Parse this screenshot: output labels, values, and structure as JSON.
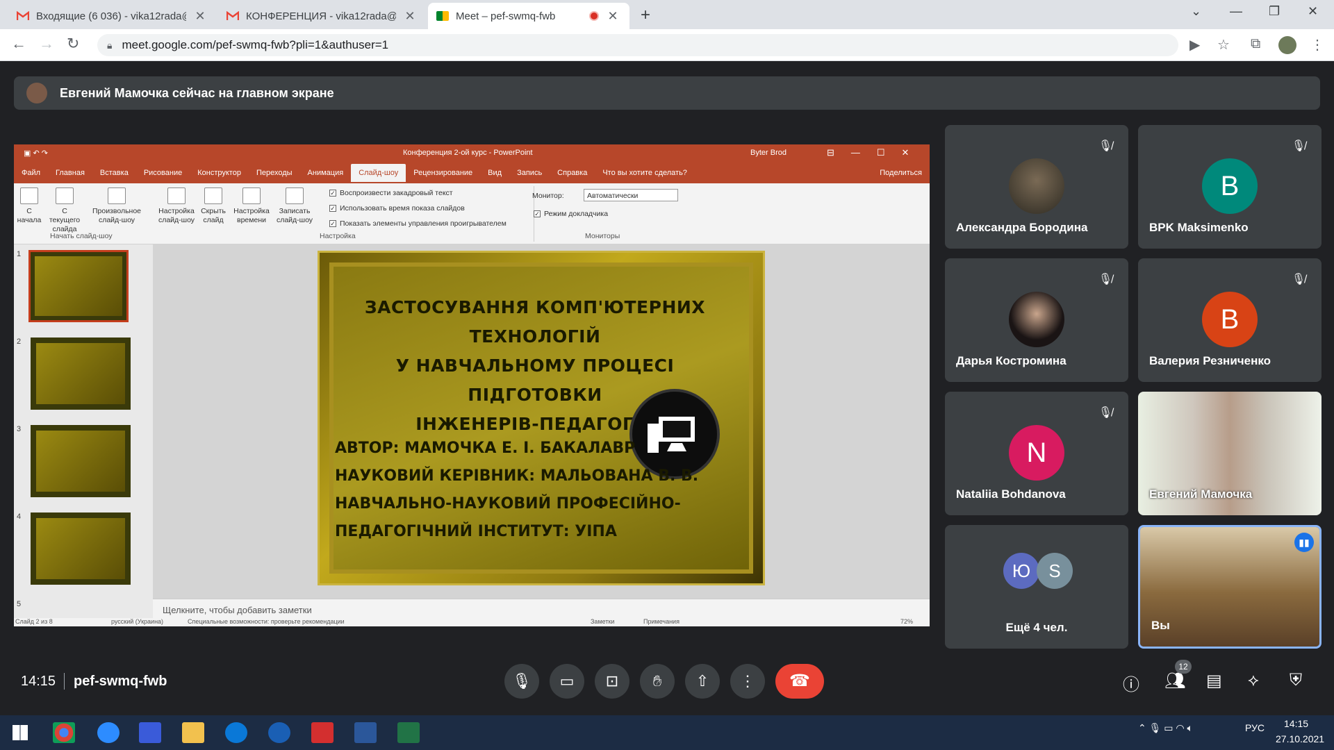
{
  "browser": {
    "tabs": [
      {
        "title": "Входящие (6 036) - vika12rada@",
        "close": "✕"
      },
      {
        "title": "КОНФЕРЕНЦИЯ - vika12rada@g",
        "close": "✕"
      },
      {
        "title": "Meet – pef-swmq-fwb",
        "close": "✕"
      }
    ],
    "new_tab": "+",
    "url": "meet.google.com/pef-swmq-fwb?pli=1&authuser=1"
  },
  "meet": {
    "banner": "Евгений Мамочка сейчас на главном экране",
    "time": "14:15",
    "meeting_code": "pef-swmq-fwb",
    "people_count": "12",
    "participants": [
      {
        "name": "Александра Бородина",
        "initial": "",
        "color": ""
      },
      {
        "name": "BPK Maksimenko",
        "initial": "B",
        "color": "#00897b"
      },
      {
        "name": "Дарья Костромина",
        "initial": "",
        "color": ""
      },
      {
        "name": "Валерия Резниченко",
        "initial": "В",
        "color": "#d84315"
      },
      {
        "name": "Nataliia Bohdanova",
        "initial": "N",
        "color": "#d81b60"
      },
      {
        "name": "Евгений Мамочка",
        "initial": "",
        "color": ""
      },
      {
        "name": "Ещё 4 чел.",
        "initial": "",
        "color": ""
      },
      {
        "name": "Вы",
        "initial": "",
        "color": ""
      }
    ],
    "more_avatars": [
      {
        "initial": "Ю",
        "color": "#5c6bc0"
      },
      {
        "initial": "S",
        "color": "#78909c"
      }
    ]
  },
  "ppt": {
    "window_title": "Конференция 2-ой курс - PowerPoint",
    "user": "Byter Brod",
    "menu": [
      "Файл",
      "Главная",
      "Вставка",
      "Рисование",
      "Конструктор",
      "Переходы",
      "Анимация",
      "Слайд-шоу",
      "Рецензирование",
      "Вид",
      "Запись",
      "Справка",
      "Что вы хотите сделать?",
      "Поделиться"
    ],
    "ribbon": {
      "buttons": [
        "С начала",
        "С текущего слайда",
        "Произвольное слайд-шоу",
        "Настройка слайд-шоу",
        "Скрыть слайд",
        "Настройка времени",
        "Записать слайд-шоу"
      ],
      "checks": [
        "Воспроизвести закадровый текст",
        "Использовать время показа слайдов",
        "Показать элементы управления проигрывателем"
      ],
      "monitor_label": "Монитор:",
      "monitor_value": "Автоматически",
      "presenter": "Режим докладчика",
      "groups": [
        "Начать слайд-шоу",
        "Настройка",
        "Мониторы"
      ]
    },
    "slide_numbers": [
      "1",
      "2",
      "3",
      "4",
      "5"
    ],
    "slide": {
      "title_lines": [
        "ЗАСТОСУВАННЯ КОМП'ЮТЕРНИХ ТЕХНОЛОГІЙ",
        "У НАВЧАЛЬНОМУ ПРОЦЕСІ ПІДГОТОВКИ",
        "ІНЖЕНЕРІВ-ПЕДАГОГІВ"
      ],
      "info_lines": [
        "АВТОР: МАМОЧКА Е. І. БАКАЛАВР",
        "НАУКОВИЙ КЕРІВНИК: МАЛЬОВАНА В. В.",
        "НАВЧАЛЬНО-НАУКОВИЙ ПРОФЕСІЙНО-",
        "ПЕДАГОГІЧНИЙ ІНСТИТУТ: УІПА"
      ]
    },
    "notes_placeholder": "Щелкните, чтобы добавить заметки",
    "status": {
      "slide": "Слайд 2 из 8",
      "lang": "русский (Украина)",
      "access": "Специальные возможности: проверьте рекомендации",
      "notes": "Заметки",
      "comments": "Примечания",
      "zoom": "72%"
    }
  },
  "taskbar": {
    "lang": "РУС",
    "time": "14:15",
    "date": "27.10.2021"
  }
}
